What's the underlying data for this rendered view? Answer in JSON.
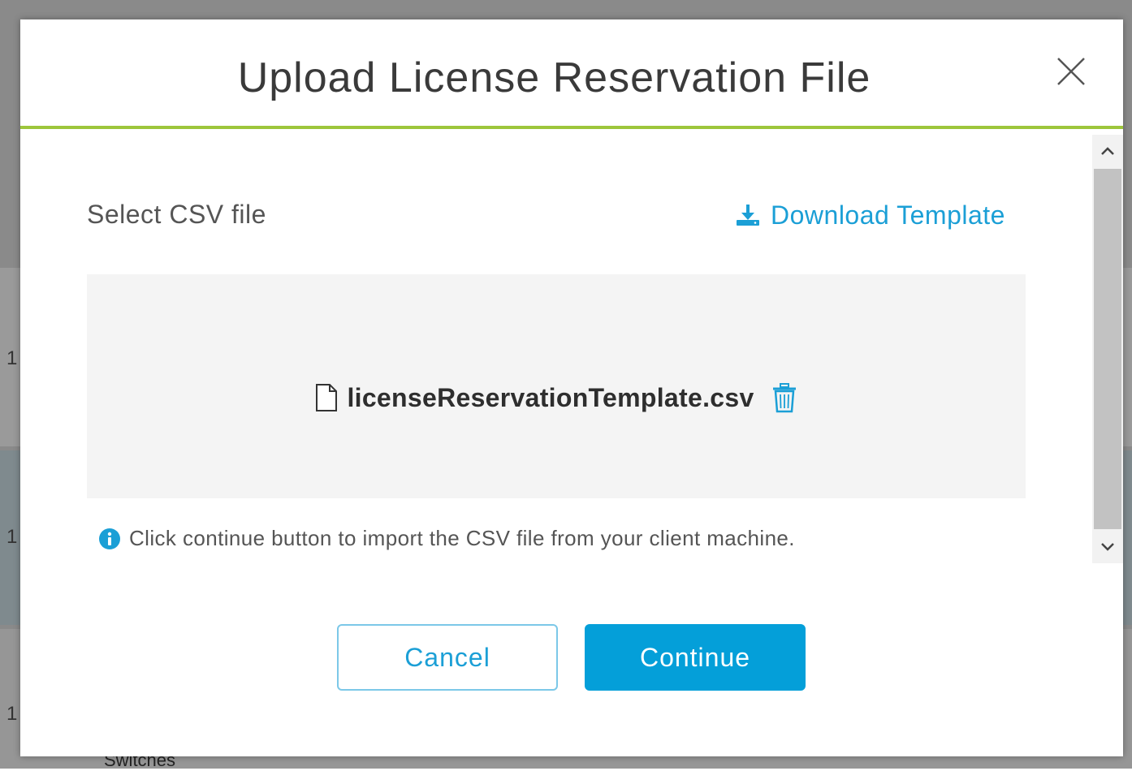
{
  "background": {
    "row_markers": [
      "1",
      "1",
      "1"
    ],
    "bottom_text": "Switches"
  },
  "modal": {
    "title": "Upload License Reservation File",
    "close_icon": "close-icon",
    "select_label": "Select CSV file",
    "download_label": "Download Template",
    "file_name": "licenseReservationTemplate.csv",
    "info_text": "Click continue button to import the CSV file from your client machine.",
    "cancel_label": "Cancel",
    "continue_label": "Continue"
  },
  "colors": {
    "accent": "#1b9fd6",
    "primary_button": "#049fd9",
    "header_divider": "#9dc63b"
  }
}
